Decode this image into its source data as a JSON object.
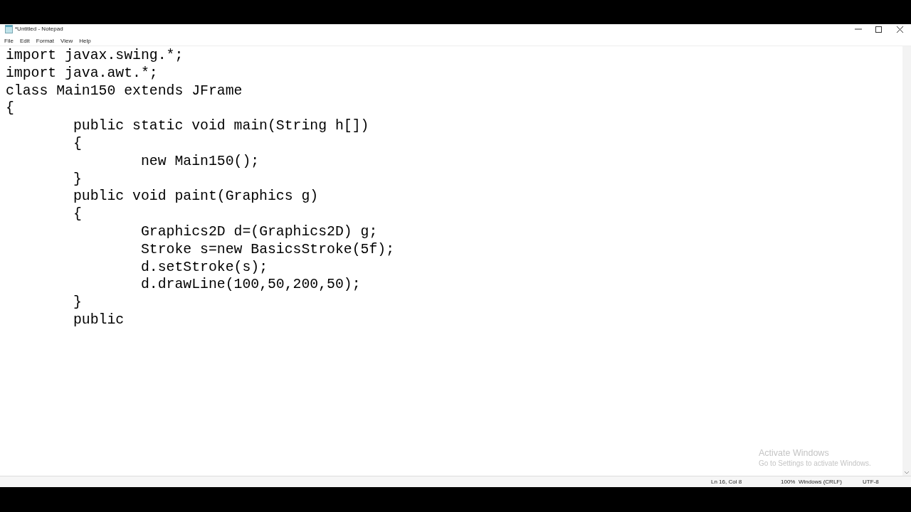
{
  "window": {
    "title": "*Untitled - Notepad"
  },
  "menu": [
    "File",
    "Edit",
    "Format",
    "View",
    "Help"
  ],
  "editor": {
    "lines": [
      "import javax.swing.*;",
      "import java.awt.*;",
      "class Main150 extends JFrame",
      "{",
      "\tpublic static void main(String h[])",
      "\t{",
      "\t\tnew Main150();",
      "\t}",
      "\tpublic void paint(Graphics g)",
      "\t{",
      "\t\tGraphics2D d=(Graphics2D) g;",
      "\t\tStroke s=new BasicsStroke(5f);",
      "\t\td.setStroke(s);",
      "\t\td.drawLine(100,50,200,50);",
      "\t}",
      "\tpublic"
    ]
  },
  "activation_notice": {
    "title": "Activate Windows",
    "subtitle": "Go to Settings to activate Windows."
  },
  "status_bar": [
    "Ln 16, Col 8",
    "100%",
    "Windows (CRLF)",
    "UTF-8"
  ]
}
